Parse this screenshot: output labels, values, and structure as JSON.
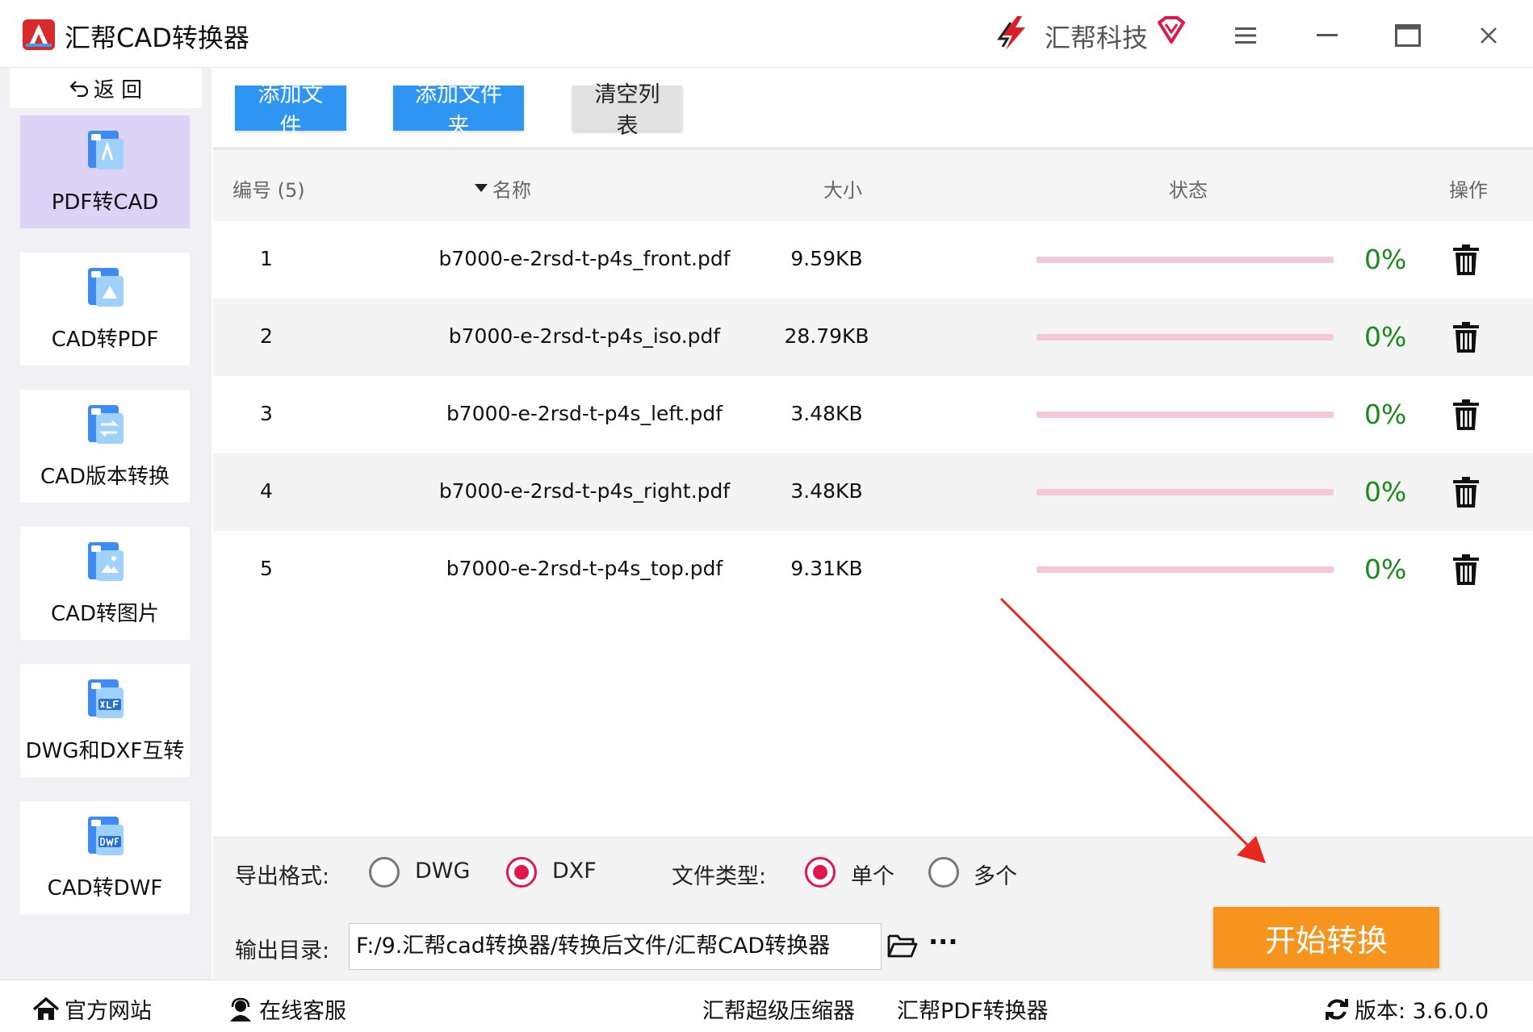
{
  "window": {
    "title": "汇帮CAD转换器",
    "brand": "汇帮科技"
  },
  "sidebar": {
    "back_label": "返 回",
    "items": [
      {
        "label": "PDF转CAD",
        "icon": "pdf-to-cad-icon",
        "active": true
      },
      {
        "label": "CAD转PDF",
        "icon": "cad-to-pdf-icon",
        "active": false
      },
      {
        "label": "CAD版本转换",
        "icon": "cad-version-icon",
        "active": false
      },
      {
        "label": "CAD转图片",
        "icon": "cad-to-image-icon",
        "active": false
      },
      {
        "label": "DWG和DXF互转",
        "icon": "dwg-dxf-icon",
        "active": false
      },
      {
        "label": "CAD转DWF",
        "icon": "cad-to-dwf-icon",
        "active": false
      }
    ]
  },
  "toolbar": {
    "add_file": "添加文件",
    "add_folder": "添加文件夹",
    "clear_list": "清空列表"
  },
  "table": {
    "headers": {
      "index": "编号 (5)",
      "name": "名称",
      "size": "大小",
      "status": "状态",
      "action": "操作"
    },
    "rows": [
      {
        "index": "1",
        "name": "b7000-e-2rsd-t-p4s_front.pdf",
        "size": "9.59KB",
        "progress": 0,
        "percent": "0%"
      },
      {
        "index": "2",
        "name": "b7000-e-2rsd-t-p4s_iso.pdf",
        "size": "28.79KB",
        "progress": 0,
        "percent": "0%"
      },
      {
        "index": "3",
        "name": "b7000-e-2rsd-t-p4s_left.pdf",
        "size": "3.48KB",
        "progress": 0,
        "percent": "0%"
      },
      {
        "index": "4",
        "name": "b7000-e-2rsd-t-p4s_right.pdf",
        "size": "3.48KB",
        "progress": 0,
        "percent": "0%"
      },
      {
        "index": "5",
        "name": "b7000-e-2rsd-t-p4s_top.pdf",
        "size": "9.31KB",
        "progress": 0,
        "percent": "0%"
      }
    ]
  },
  "options": {
    "format_label": "导出格式:",
    "format_dwg": "DWG",
    "format_dxf": "DXF",
    "format_selected": "DXF",
    "filetype_label": "文件类型:",
    "filetype_single": "单个",
    "filetype_multiple": "多个",
    "filetype_selected": "单个",
    "output_label": "输出目录:",
    "output_path": "F:/9.汇帮cad转换器/转换后文件/汇帮CAD转换器",
    "more": "···",
    "start": "开始转换"
  },
  "statusbar": {
    "website": "官方网站",
    "support": "在线客服",
    "compressor": "汇帮超级压缩器",
    "pdf_converter": "汇帮PDF转换器",
    "version": "版本: 3.6.0.0"
  },
  "colors": {
    "accent_blue": "#2e95f2",
    "start_orange": "#f7941d",
    "radio_red": "#e0174d",
    "percent_green": "#1a8a1a",
    "progress_track": "#f3c9d4",
    "active_sidebar": "#dcd3f7"
  }
}
